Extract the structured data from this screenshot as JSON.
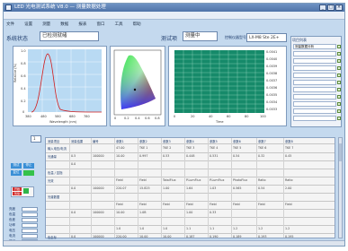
{
  "window": {
    "title": "LED 光电测试系统 V8.0 — 测量数据处理",
    "controls": [
      "_",
      "□",
      "×"
    ]
  },
  "menu": [
    "文件",
    "设置",
    "测量",
    "数据",
    "报表",
    "窗口",
    "工具",
    "帮助"
  ],
  "header": {
    "system_status_label": "系统状态",
    "system_status_value": "已检测就绪",
    "test_item_label": "测试项",
    "test_item_value": "测量中",
    "meter_label": "控制仪器型号",
    "meter_value": "LX-M8 Ste 2E+"
  },
  "spectrum_chart": {
    "y_ticks": [
      "1.0",
      "0.8",
      "0.6",
      "0.4",
      "0.2",
      "0"
    ],
    "x_ticks": [
      "380",
      "480",
      "580",
      "680",
      "780"
    ],
    "ylabel": "Relative (%)",
    "xlabel": "Wavelength (nm)"
  },
  "cie_chart": {
    "x_ticks": [
      "0",
      "0.2",
      "0.4",
      "0.6",
      "0.8"
    ]
  },
  "grid_chart": {
    "right_ticks": [
      "0.0041",
      "0.0040",
      "0.0039",
      "0.0038",
      "0.0037",
      "0.0036",
      "0.0035",
      "0.0034",
      "0.0033"
    ],
    "x_ticks": [
      "0",
      "20",
      "40",
      "60",
      "80",
      "100"
    ],
    "xlabel": "Time"
  },
  "side_panel": {
    "header": "项目列表",
    "first_row": "测量数据分析",
    "rows": 11
  },
  "left_tools": {
    "top_value": "1",
    "buttons": [
      "测试",
      "停止",
      "复位"
    ],
    "red_buttons": [
      "开始",
      "暂停"
    ],
    "status_labels": [
      "亮度",
      "色温",
      "色差",
      "功率",
      "电压",
      "电流",
      "时间"
    ]
  },
  "table": {
    "header": [
      "测量项目",
      "测量结果",
      "编号",
      "参数1",
      "参数2",
      "参数3",
      "参数4",
      "参数5",
      "参数6",
      "参数7",
      "参数8"
    ],
    "rows": [
      [
        "输入电压/电流",
        "",
        "",
        "47.00",
        "TKE 1",
        "TKE 2",
        "TKE 3",
        "TKE 4",
        "TKE 5",
        "TKE 6",
        "TKE 7"
      ],
      [
        "光通量",
        "0.5",
        "100000",
        "10.00",
        "0.997",
        "0.53",
        "0.448",
        "0.531",
        "0.54",
        "0.32",
        "0.45"
      ],
      [
        "",
        "0.0",
        "",
        "",
        "",
        "",
        "",
        "",
        "",
        "",
        ""
      ],
      [
        "色温 / 显指",
        "",
        "",
        "",
        "",
        "",
        "",
        "",
        "",
        "",
        ""
      ],
      [
        "光效",
        "",
        "",
        "Field",
        "Field",
        "TotalFlux",
        "P.LumFlux",
        "P.LumFlux",
        "PhotoFlux",
        "Ratio",
        "Ratio"
      ],
      [
        "",
        "0.0",
        "100000",
        "220.07",
        "15.825",
        "1.00",
        "1.64",
        "1.03",
        "0.565",
        "0.54",
        "2.00"
      ],
      [
        "光谱数据",
        "",
        "",
        "",
        "",
        "",
        "",
        "",
        "",
        "",
        ""
      ],
      [
        "",
        "",
        "",
        "Field",
        "Field",
        "Field",
        "Field",
        "Field",
        "Field",
        "Field",
        "Field"
      ],
      [
        "",
        "0.0",
        "100000",
        "10.00",
        "1.0B",
        "",
        "1.00",
        "0.33",
        "",
        "",
        ""
      ],
      [
        "",
        "",
        "",
        "",
        "",
        "",
        "",
        "",
        "",
        "",
        ""
      ],
      [
        "",
        "",
        "",
        "1.0",
        "1.0",
        "1.0",
        "1.1",
        "1.1",
        "1.2",
        "1.2",
        "1.2"
      ],
      [
        "色坐标",
        "0.0",
        "100000",
        "220.00",
        "10.00",
        "10.00",
        "0.187",
        "0.190",
        "0.189",
        "0.193",
        "0.195"
      ]
    ]
  }
}
